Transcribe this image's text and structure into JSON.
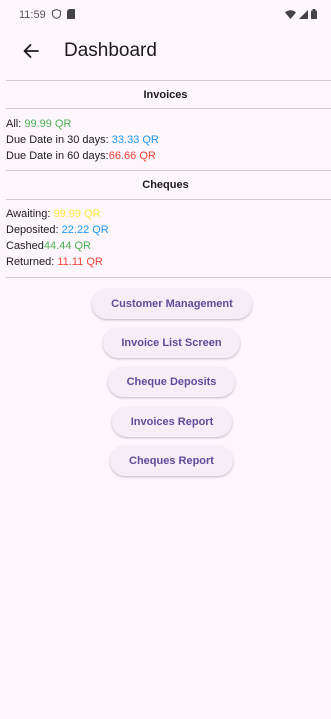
{
  "status_bar": {
    "time": "11:59"
  },
  "app_bar": {
    "title": "Dashboard"
  },
  "invoices": {
    "header": "Invoices",
    "rows": [
      {
        "label": "All: ",
        "value": "99.99 QR",
        "color": "#4caf50"
      },
      {
        "label": "Due Date in 30 days: ",
        "value": "33.33 QR",
        "color": "#2196f3"
      },
      {
        "label": "Due Date in 60 days:",
        "value": "66.66 QR",
        "color": "#f44336"
      }
    ]
  },
  "cheques": {
    "header": "Cheques",
    "rows": [
      {
        "label": "Awaiting: ",
        "value": "99.99 QR",
        "color": "#ffeb3b"
      },
      {
        "label": "Deposited: ",
        "value": "22.22 QR",
        "color": "#2196f3"
      },
      {
        "label": "Cashed",
        "value": "44.44 QR",
        "color": "#4caf50"
      },
      {
        "label": "Returned: ",
        "value": "11.11 QR",
        "color": "#f44336"
      }
    ]
  },
  "actions": {
    "customer_management": "Customer Management",
    "invoice_list_screen": "Invoice List Screen",
    "cheque_deposits": "Cheque Deposits",
    "invoices_report": "Invoices Report",
    "cheques_report": "Cheques Report"
  },
  "colors": {
    "background": "#fdf7fd",
    "button_bg": "#f6eef7",
    "button_text": "#5d4d9b"
  }
}
